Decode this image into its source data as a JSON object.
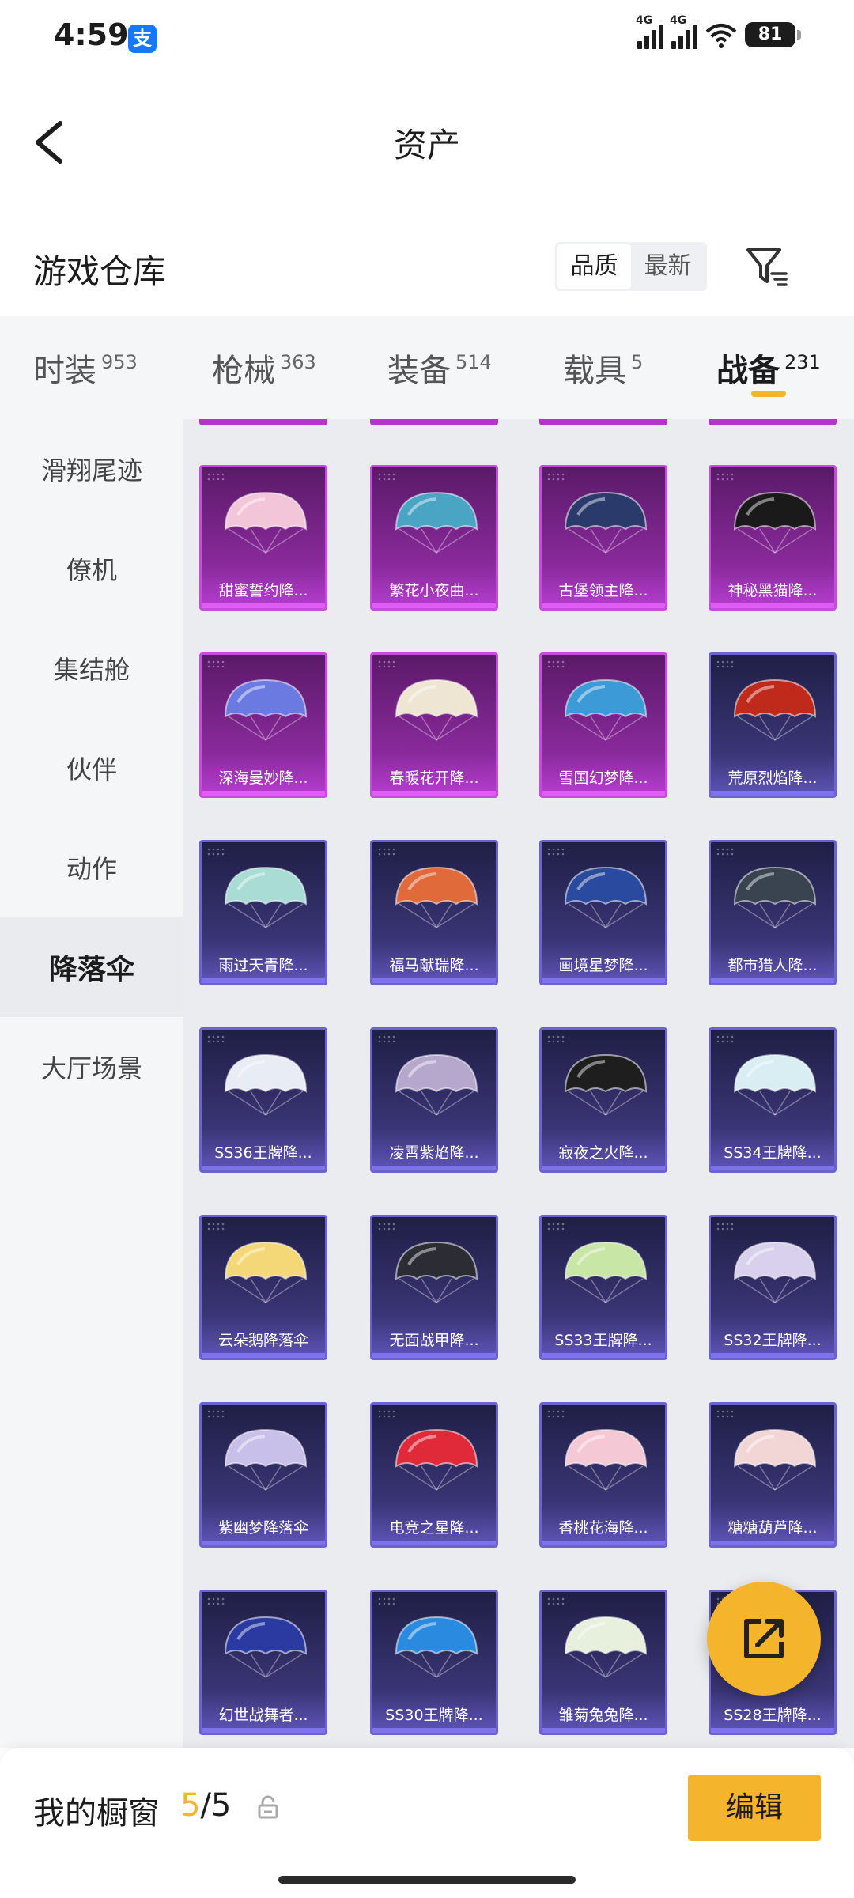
{
  "status_bar": {
    "time": "4:59",
    "alipay_badge": "支",
    "signal1": "4G",
    "signal2": "4G",
    "battery": "81"
  },
  "header": {
    "title": "资产"
  },
  "section": {
    "title": "游戏仓库",
    "sort_quality": "品质",
    "sort_newest": "最新",
    "sort_active": "quality"
  },
  "categories": [
    {
      "name": "时装",
      "count": "953"
    },
    {
      "name": "枪械",
      "count": "363"
    },
    {
      "name": "装备",
      "count": "514"
    },
    {
      "name": "载具",
      "count": "5"
    },
    {
      "name": "战备",
      "count": "231",
      "active": true
    }
  ],
  "side_nav": [
    {
      "label": "滑翔尾迹"
    },
    {
      "label": "僚机"
    },
    {
      "label": "集结舱"
    },
    {
      "label": "伙伴"
    },
    {
      "label": "动作"
    },
    {
      "label": "降落伞",
      "active": true
    },
    {
      "label": "大厅场景"
    }
  ],
  "items": [
    {
      "name": "甜蜜誓约降...",
      "rarity": "purple",
      "color": "#f2c6d8"
    },
    {
      "name": "繁花小夜曲...",
      "rarity": "purple",
      "color": "#4aa4c4"
    },
    {
      "name": "古堡领主降...",
      "rarity": "purple",
      "color": "#2a3a6a"
    },
    {
      "name": "神秘黑猫降...",
      "rarity": "purple",
      "color": "#1a1a1a"
    },
    {
      "name": "深海曼妙降...",
      "rarity": "purple",
      "color": "#6a7ae0"
    },
    {
      "name": "春暖花开降...",
      "rarity": "purple",
      "color": "#eee6d2"
    },
    {
      "name": "雪国幻梦降...",
      "rarity": "purple",
      "color": "#3c9ad6"
    },
    {
      "name": "荒原烈焰降...",
      "rarity": "blue",
      "color": "#c02a1a"
    },
    {
      "name": "雨过天青降...",
      "rarity": "blue",
      "color": "#a8dcd4"
    },
    {
      "name": "福马献瑞降...",
      "rarity": "blue",
      "color": "#e06a3a"
    },
    {
      "name": "画境星梦降...",
      "rarity": "blue",
      "color": "#2a4aa0"
    },
    {
      "name": "都市猎人降...",
      "rarity": "blue",
      "color": "#3a4450"
    },
    {
      "name": "SS36王牌降...",
      "rarity": "blue",
      "color": "#e8ecf4"
    },
    {
      "name": "凌霄紫焰降...",
      "rarity": "blue",
      "color": "#b6a8cc"
    },
    {
      "name": "寂夜之火降...",
      "rarity": "blue",
      "color": "#1e1e1e"
    },
    {
      "name": "SS34王牌降...",
      "rarity": "blue",
      "color": "#d8eef2"
    },
    {
      "name": "云朵鹅降落伞",
      "rarity": "blue",
      "color": "#f4d878"
    },
    {
      "name": "无面战甲降...",
      "rarity": "blue",
      "color": "#2c2c34"
    },
    {
      "name": "SS33王牌降...",
      "rarity": "blue",
      "color": "#c8e6a6"
    },
    {
      "name": "SS32王牌降...",
      "rarity": "blue",
      "color": "#d8d0ec"
    },
    {
      "name": "紫幽梦降落伞",
      "rarity": "blue",
      "color": "#c8c0e8"
    },
    {
      "name": "电竞之星降...",
      "rarity": "blue",
      "color": "#e02a3a"
    },
    {
      "name": "香桃花海降...",
      "rarity": "blue",
      "color": "#f4c8d4"
    },
    {
      "name": "糖糖葫芦降...",
      "rarity": "blue",
      "color": "#f2d6d6"
    },
    {
      "name": "幻世战舞者...",
      "rarity": "blue",
      "color": "#2a3aa0"
    },
    {
      "name": "SS30王牌降...",
      "rarity": "blue",
      "color": "#2a8ae0"
    },
    {
      "name": "雏菊兔兔降...",
      "rarity": "blue",
      "color": "#e6f0dc"
    },
    {
      "name": "SS28王牌降...",
      "rarity": "blue",
      "color": "#8a3a3a"
    }
  ],
  "showcase": {
    "label": "我的橱窗",
    "current": "5",
    "total": "/5",
    "edit_label": "编辑"
  },
  "colors": {
    "accent": "#f4b52c",
    "purple_frame": "#c34ed9",
    "blue_frame": "#6d63cf"
  }
}
